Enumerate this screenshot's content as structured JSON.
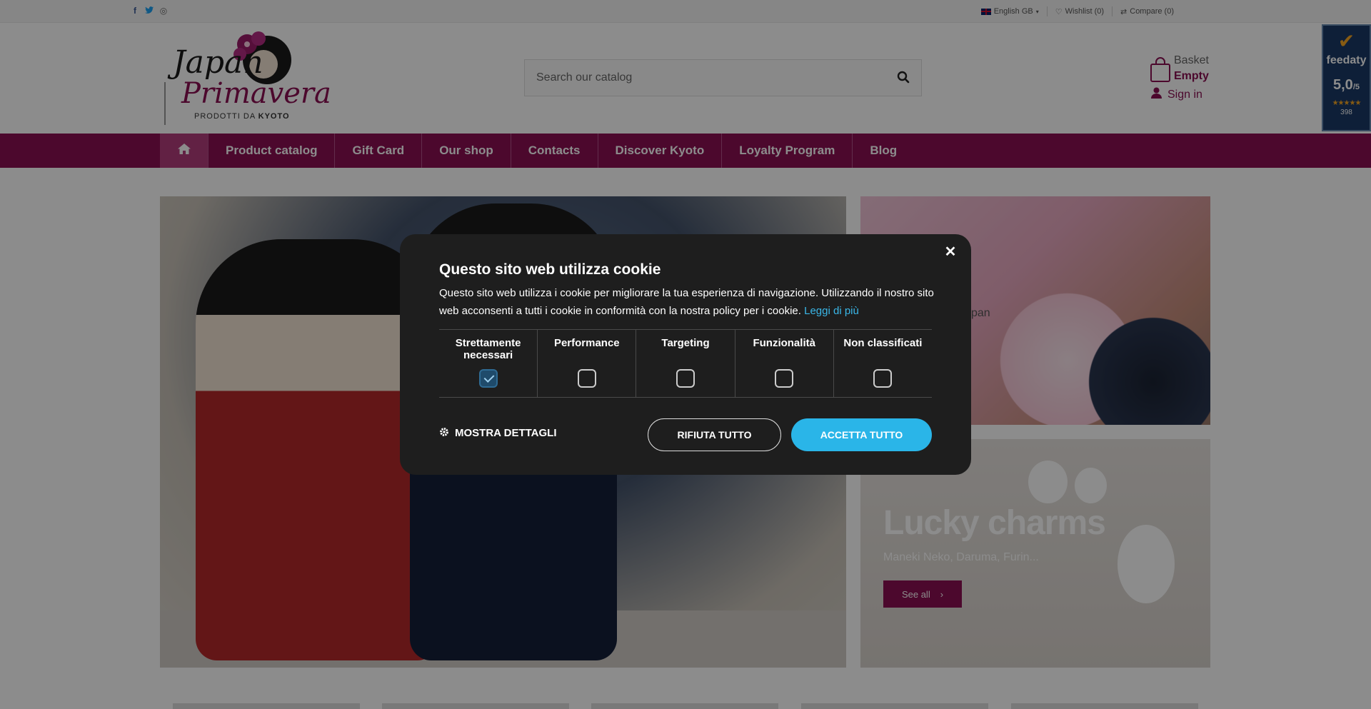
{
  "topbar": {
    "social": {
      "facebook": "f",
      "twitter": "t",
      "instagram": "◎"
    },
    "language": "English GB",
    "wishlist": "Wishlist (0)",
    "compare": "Compare (0)"
  },
  "header": {
    "logo_line1": "Japan",
    "logo_line2": "Primavera",
    "logo_tagline_prefix": "PRODOTTI DA",
    "logo_tagline_city": "KYOTO",
    "search_placeholder": "Search our catalog",
    "basket_label": "Basket",
    "basket_status": "Empty",
    "signin": "Sign in"
  },
  "feedaty": {
    "name": "feedaty",
    "score": "5,0",
    "score_suffix": "/5",
    "stars": "★★★★★",
    "count": "398"
  },
  "nav": {
    "items": [
      {
        "label": "Product catalog"
      },
      {
        "label": "Gift Card"
      },
      {
        "label": "Our shop"
      },
      {
        "label": "Contacts"
      },
      {
        "label": "Discover Kyoto"
      },
      {
        "label": "Loyalty Program"
      },
      {
        "label": "Blog"
      }
    ]
  },
  "cards": {
    "fan_text": "pan",
    "charms_title": "Lucky charms",
    "charms_sub": "Maneki Neko, Daruma, Furin...",
    "charms_btn": "See all",
    "charms_btn_arrow": "›"
  },
  "cookie": {
    "title": "Questo sito web utilizza cookie",
    "body": "Questo sito web utilizza i cookie per migliorare la tua esperienza di navigazione. Utilizzando il nostro sito web acconsenti a tutti i cookie in conformità con la nostra policy per i cookie.",
    "link": "Leggi di più",
    "categories": [
      {
        "label": "Strettamente necessari",
        "checked": true
      },
      {
        "label": "Performance",
        "checked": false
      },
      {
        "label": "Targeting",
        "checked": false
      },
      {
        "label": "Funzionalità",
        "checked": false
      },
      {
        "label": "Non classificati",
        "checked": false
      }
    ],
    "details": "MOSTRA DETTAGLI",
    "reject": "RIFIUTA TUTTO",
    "accept": "ACCETTA TUTTO",
    "close": "✕"
  },
  "colors": {
    "brand": "#8a1052",
    "accept": "#2ab5e8",
    "modal_bg": "#1e1e1e"
  }
}
